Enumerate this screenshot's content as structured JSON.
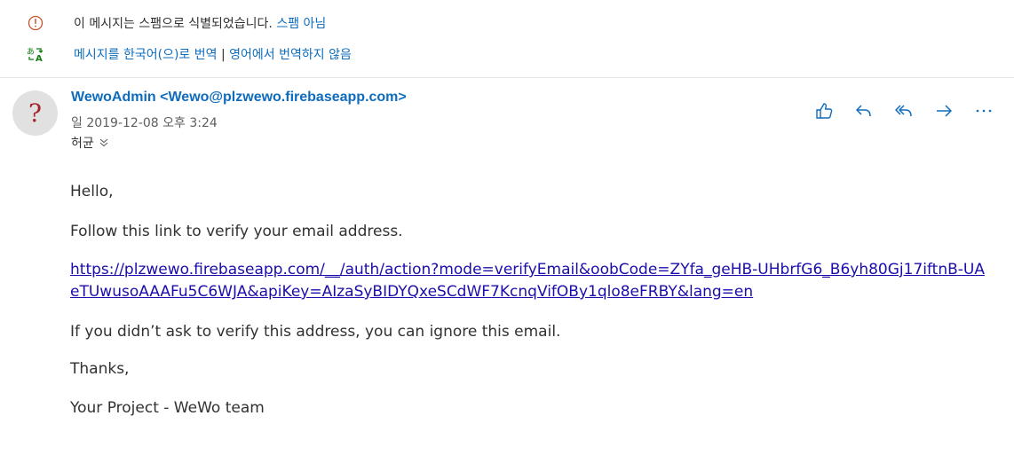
{
  "banner": {
    "spam_text": "이 메시지는 스팸으로 식별되었습니다.",
    "not_spam_link": "스팸 아님",
    "translate_link": "메시지를 한국어(으)로 번역",
    "separator": "|",
    "no_translate_link": "영어에서 번역하지 않음"
  },
  "header": {
    "avatar_char": "?",
    "sender": "WewoAdmin <Wewo@plzwewo.firebaseapp.com>",
    "date": "일 2019-12-08 오후 3:24",
    "recipient": "허균"
  },
  "actions": [
    {
      "name": "like-icon"
    },
    {
      "name": "reply-icon"
    },
    {
      "name": "reply-all-icon"
    },
    {
      "name": "forward-icon"
    },
    {
      "name": "more-icon"
    }
  ],
  "body": {
    "greeting": "Hello,",
    "line1": "Follow this link to verify your email address.",
    "link": "https://plzwewo.firebaseapp.com/__/auth/action?mode=verifyEmail&oobCode=ZYfa_geHB-UHbrfG6_B6yh80Gj17iftnB-UAeTUwusoAAAFu5C6WJA&apiKey=AIzaSyBIDYQxeSCdWF7KcnqVifOBy1qlo8eFRBY&lang=en",
    "line2": "If you didn’t ask to verify this address, you can ignore this email.",
    "thanks": "Thanks,",
    "signature": "Your Project - WeWo team"
  },
  "colors": {
    "accent": "#0f6cbd",
    "warning": "#c4532a",
    "translate": "#107c10",
    "link": "#1a0dab"
  }
}
